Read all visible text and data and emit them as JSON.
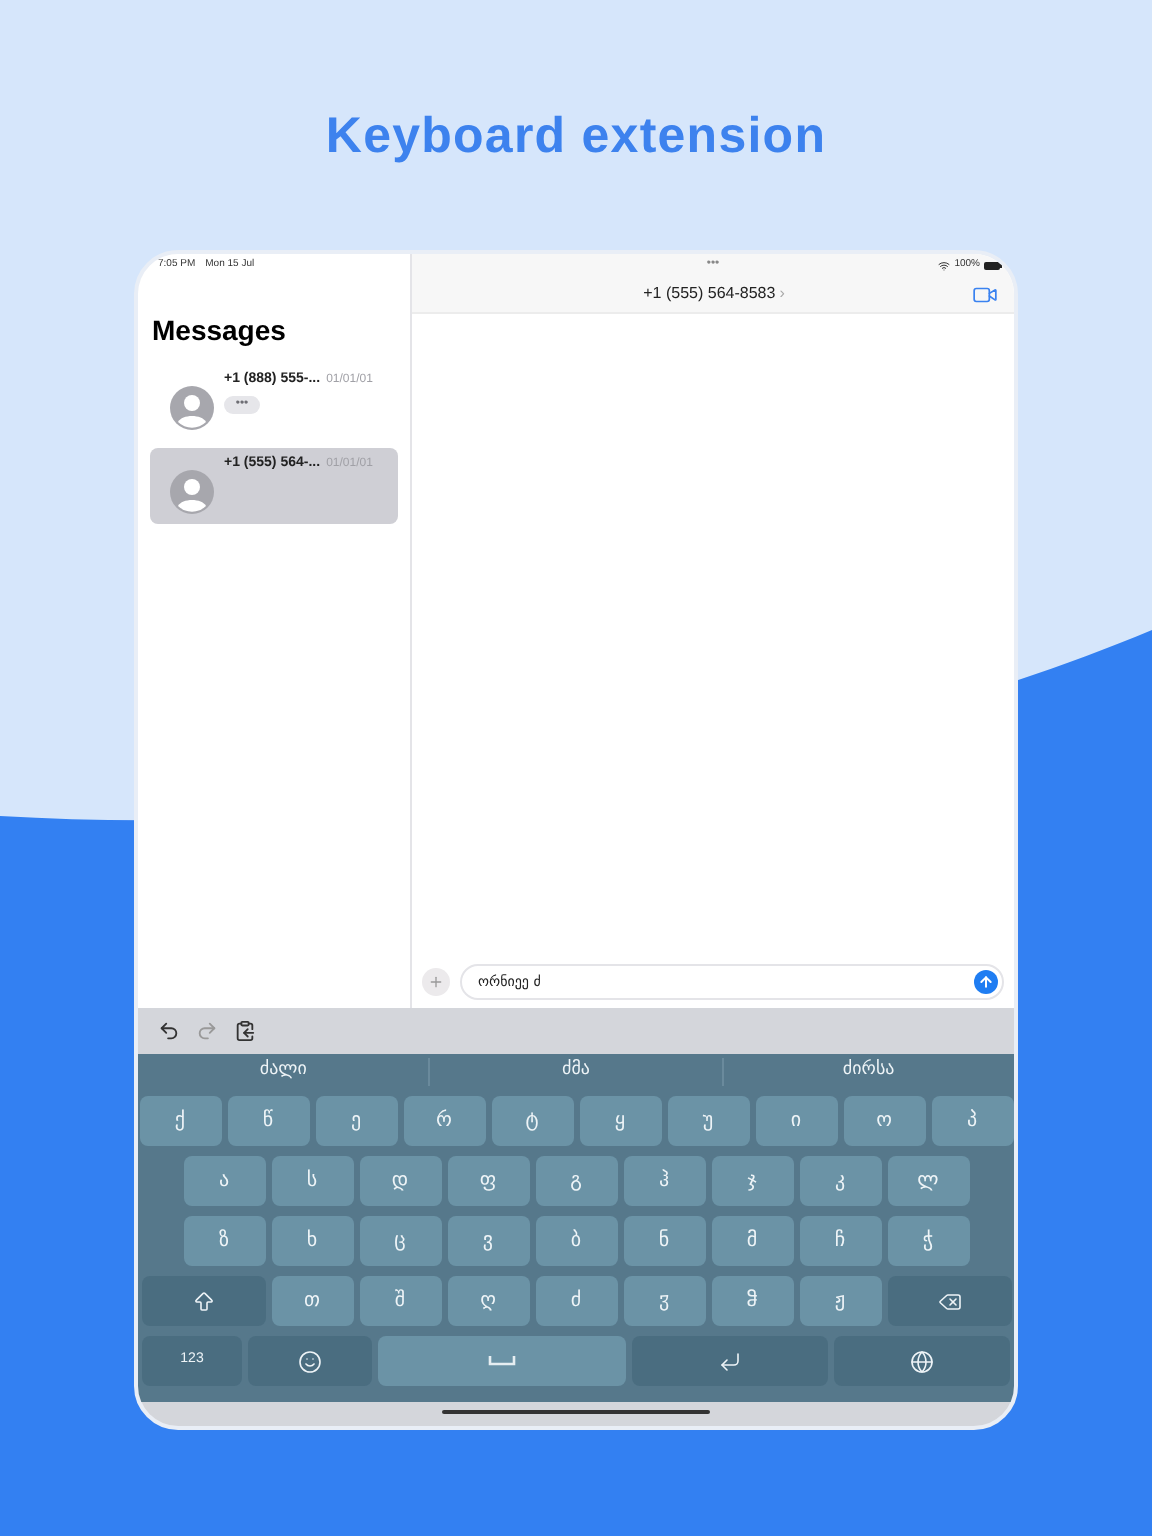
{
  "headline": "Keyboard extension",
  "status_bar": {
    "time": "7:05 PM",
    "date": "Mon 15 Jul",
    "dots": "•••",
    "battery": "100%"
  },
  "sidebar": {
    "title": "Messages",
    "conversations": [
      {
        "name": "+1 (888) 555-...",
        "date": "01/01/01",
        "preview": "•••",
        "selected": false
      },
      {
        "name": "+1 (555) 564-...",
        "date": "01/01/01",
        "selected": true
      }
    ]
  },
  "chat": {
    "title": "+1 (555) 564-8583",
    "chevron": "›",
    "message_field": {
      "value": "ორნიეე ძ"
    }
  },
  "keyboard": {
    "suggestions": [
      "ძალი",
      "ძმა",
      "ძირსა"
    ],
    "rows": [
      [
        {
          "kind": "letter",
          "label": "ქ"
        },
        {
          "kind": "letter",
          "label": "წ"
        },
        {
          "kind": "letter",
          "label": "ე"
        },
        {
          "kind": "letter",
          "label": "რ"
        },
        {
          "kind": "letter",
          "label": "ტ"
        },
        {
          "kind": "letter",
          "label": "ყ"
        },
        {
          "kind": "letter",
          "label": "უ"
        },
        {
          "kind": "letter",
          "label": "ი"
        },
        {
          "kind": "letter",
          "label": "ო"
        },
        {
          "kind": "letter",
          "label": "პ"
        }
      ],
      [
        {
          "kind": "letter",
          "label": "ა"
        },
        {
          "kind": "letter",
          "label": "ს"
        },
        {
          "kind": "letter",
          "label": "დ"
        },
        {
          "kind": "letter",
          "label": "ფ"
        },
        {
          "kind": "letter",
          "label": "გ"
        },
        {
          "kind": "letter",
          "label": "ჰ"
        },
        {
          "kind": "letter",
          "label": "ჯ"
        },
        {
          "kind": "letter",
          "label": "კ"
        },
        {
          "kind": "letter",
          "label": "ლ"
        }
      ],
      [
        {
          "kind": "letter",
          "label": "ზ"
        },
        {
          "kind": "letter",
          "label": "ხ"
        },
        {
          "kind": "letter",
          "label": "ც"
        },
        {
          "kind": "letter",
          "label": "ვ"
        },
        {
          "kind": "letter",
          "label": "ბ"
        },
        {
          "kind": "letter",
          "label": "ნ"
        },
        {
          "kind": "letter",
          "label": "მ"
        },
        {
          "kind": "letter",
          "label": "ჩ"
        },
        {
          "kind": "letter",
          "label": "ჭ"
        }
      ],
      [
        {
          "kind": "shift"
        },
        {
          "kind": "letter",
          "label": "თ"
        },
        {
          "kind": "letter",
          "label": "შ"
        },
        {
          "kind": "letter",
          "label": "ღ"
        },
        {
          "kind": "letter",
          "label": "ძ"
        },
        {
          "kind": "letter",
          "label": "ჳ"
        },
        {
          "kind": "letter",
          "label": "ჵ"
        },
        {
          "kind": "letter",
          "label": "ჟ"
        },
        {
          "kind": "delete"
        }
      ],
      [
        {
          "kind": "numbers",
          "label": "123"
        },
        {
          "kind": "emoji"
        },
        {
          "kind": "space"
        },
        {
          "kind": "return"
        },
        {
          "kind": "globe"
        }
      ]
    ]
  }
}
